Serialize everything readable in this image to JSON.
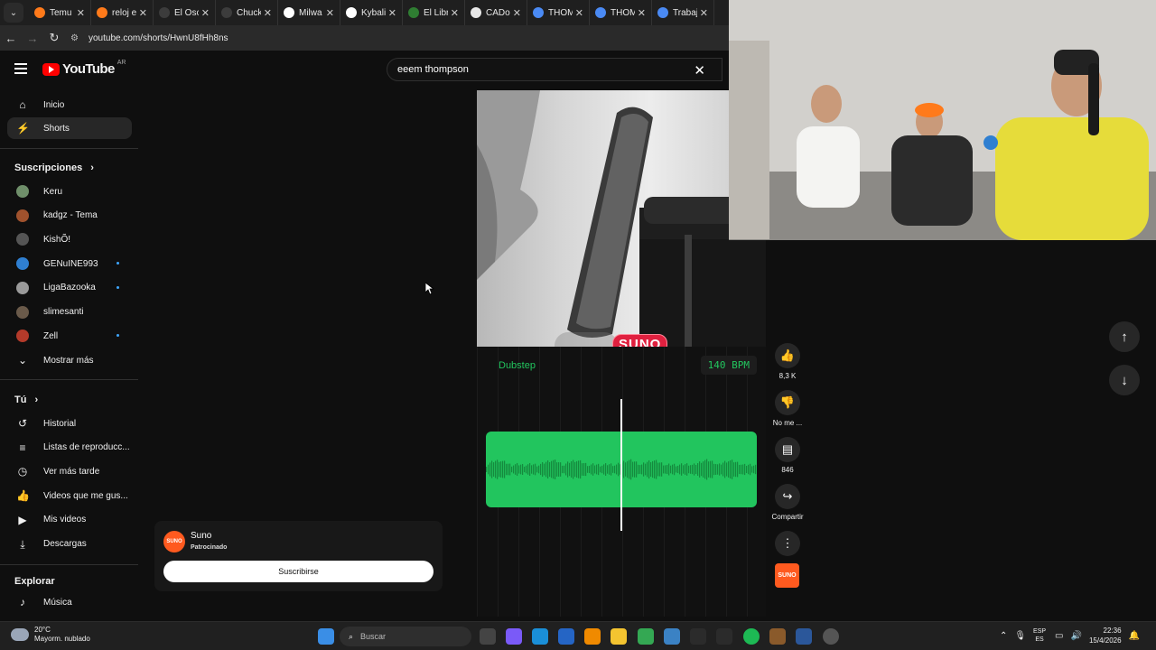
{
  "browser": {
    "tabs": [
      {
        "title": "Temu",
        "color": "#ff7a1a"
      },
      {
        "title": "reloj e",
        "color": "#ff7a1a"
      },
      {
        "title": "El Osc",
        "color": "#3c3c3c"
      },
      {
        "title": "Chuck",
        "color": "#3c3c3c"
      },
      {
        "title": "Milwa",
        "color": "#ffffff"
      },
      {
        "title": "Kybali",
        "color": "#ffffff"
      },
      {
        "title": "El Libr",
        "color": "#2f7d32"
      },
      {
        "title": "CADo",
        "color": "#e8e8e8"
      },
      {
        "title": "THOM",
        "color": "#4a8af4"
      },
      {
        "title": "THOM",
        "color": "#4a8af4"
      },
      {
        "title": "Trabaj",
        "color": "#4a8af4"
      }
    ],
    "url": "youtube.com/shorts/HwnU8fHh8ns"
  },
  "header": {
    "logo_text": "YouTube",
    "country": "AR",
    "search_value": "eeem thompson"
  },
  "sidebar": {
    "items": [
      {
        "label": "Inicio"
      },
      {
        "label": "Shorts"
      }
    ],
    "subscriptions_title": "Suscripciones",
    "subscriptions": [
      {
        "label": "Keru",
        "color": "#6f8f6a",
        "dot": false
      },
      {
        "label": "kadgz - Tema",
        "color": "#a0522d",
        "dot": false
      },
      {
        "label": "KishÕ!",
        "color": "#555555",
        "dot": false
      },
      {
        "label": "GENuINE993",
        "color": "#2f7fd1",
        "dot": true
      },
      {
        "label": "LigaBazooka",
        "color": "#9a9a9a",
        "dot": true
      },
      {
        "label": "slimesanti",
        "color": "#6a5a4a",
        "dot": false
      },
      {
        "label": "Zell",
        "color": "#b33a2a",
        "dot": true
      }
    ],
    "show_more": "Mostrar más",
    "you_title": "Tú",
    "you_items": [
      {
        "label": "Historial"
      },
      {
        "label": "Listas de reproducc..."
      },
      {
        "label": "Ver más tarde"
      },
      {
        "label": "Videos que me gus..."
      },
      {
        "label": "Mis videos"
      },
      {
        "label": "Descargas"
      }
    ],
    "explore_title": "Explorar",
    "explore_items": [
      {
        "label": "Música"
      }
    ]
  },
  "short": {
    "genre": "Dubstep",
    "bpm": "140 BPM",
    "brand": "SUNO",
    "playback_position": 0.5
  },
  "actions": {
    "likes": "8,3 K",
    "dislike": "No me ...",
    "comments": "846",
    "share": "Compartir"
  },
  "ad": {
    "logo": "SUNO",
    "name": "Suno",
    "sponsored": "Patrocinado",
    "subscribe": "Suscribirse"
  },
  "taskbar": {
    "temp": "20°C",
    "weather": "Mayorm. nublado",
    "search": "Buscar",
    "lang1": "ESP",
    "lang2": "ES",
    "time": "22:36",
    "date": "15/4/2026"
  }
}
